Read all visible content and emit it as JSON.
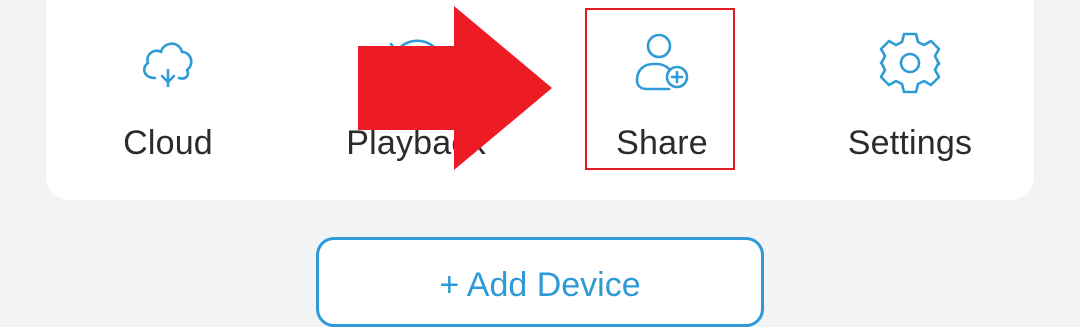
{
  "colors": {
    "accent": "#2e9bd6",
    "highlight": "#e01b24",
    "arrow": "#ed1c24",
    "label": "#2b2b2b"
  },
  "actions": [
    {
      "label": "Cloud",
      "icon": "cloud-icon"
    },
    {
      "label": "Playback",
      "icon": "playback-icon"
    },
    {
      "label": "Share",
      "icon": "share-user-icon"
    },
    {
      "label": "Settings",
      "icon": "gear-icon"
    }
  ],
  "add_device": {
    "label": "+ Add Device",
    "icon": "plus-icon"
  },
  "annotation": {
    "arrow_icon": "red-arrow-right",
    "highlight_target": "Share"
  }
}
